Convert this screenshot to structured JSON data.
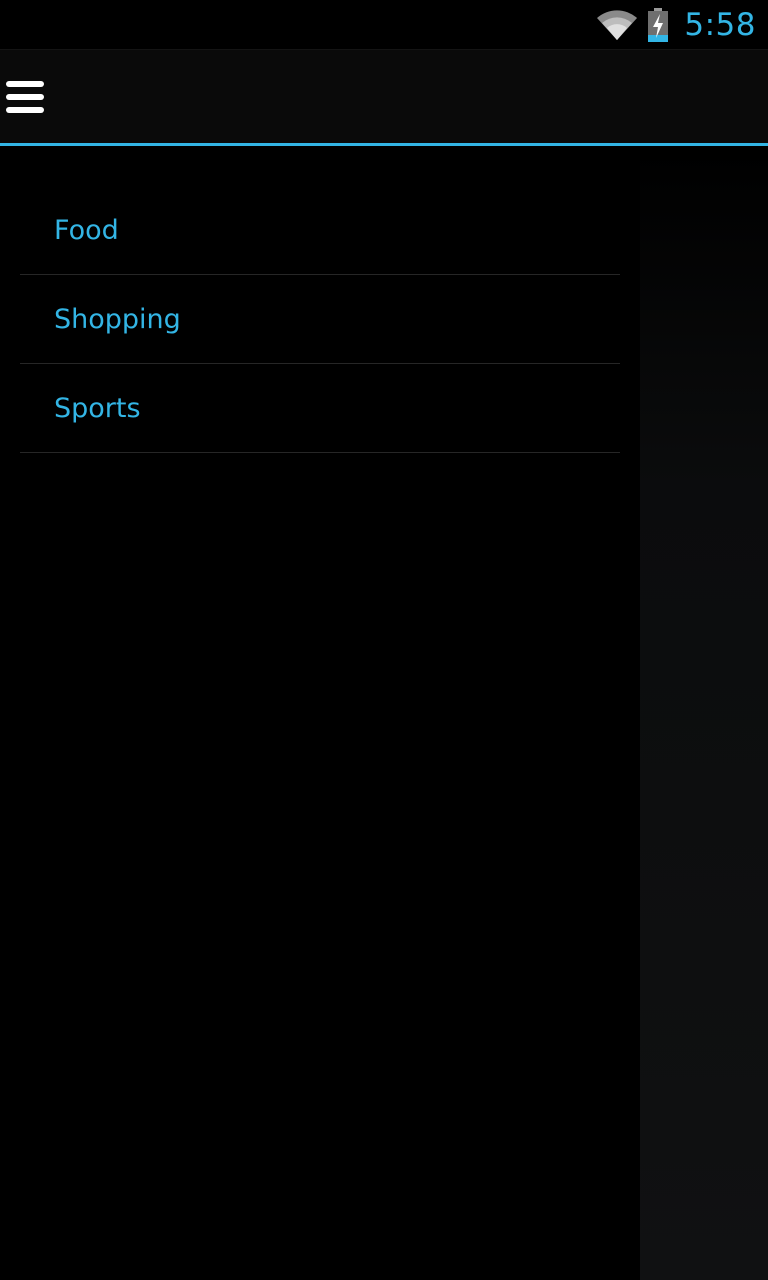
{
  "status_bar": {
    "time": "5:58",
    "wifi_icon": "wifi-icon",
    "battery_icon": "battery-charging-icon"
  },
  "action_bar": {
    "menu_icon": "hamburger-menu-icon",
    "accent_color": "#33b5e5"
  },
  "drawer": {
    "items": [
      {
        "label": "Food"
      },
      {
        "label": "Shopping"
      },
      {
        "label": "Sports"
      }
    ]
  },
  "colors": {
    "accent": "#33b5e5",
    "background": "#000000"
  }
}
